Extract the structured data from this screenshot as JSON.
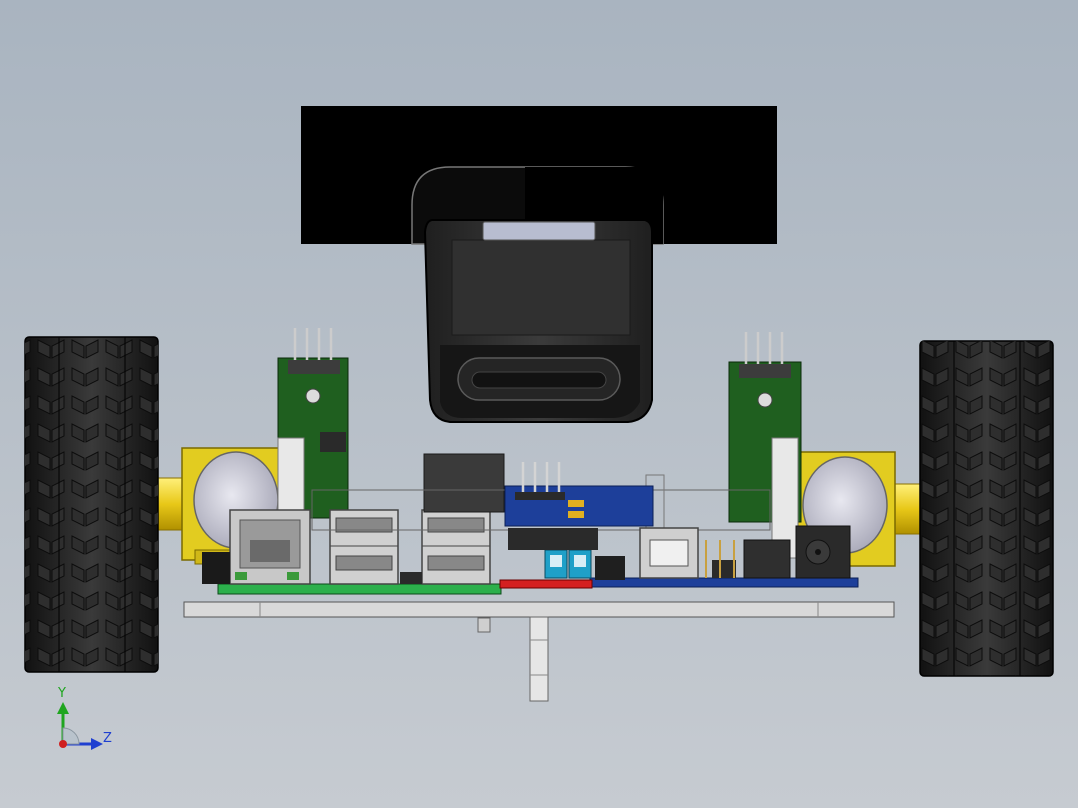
{
  "viewport": {
    "background_top": "#a9b4c0",
    "background_bottom": "#c6cbd1"
  },
  "triad": {
    "y_label": "Y",
    "z_label": "Z",
    "y_color": "#1fa51f",
    "z_color": "#1f3fd0",
    "x_color": "#d01f1f"
  },
  "model": {
    "camera_hood_color": "#000000",
    "camera_body_color": "#2a2a2a",
    "tire_color": "#1c1c1c",
    "motor_mount_color": "#e2cc20",
    "axle_color": "#f0d020",
    "sensor_board_color": "#1f5f1f",
    "main_board_color": "#2cb04c",
    "controller_board_color": "#1d3f9a",
    "red_board_color": "#d42020",
    "chassis_plate_color": "#d8d8d8"
  }
}
